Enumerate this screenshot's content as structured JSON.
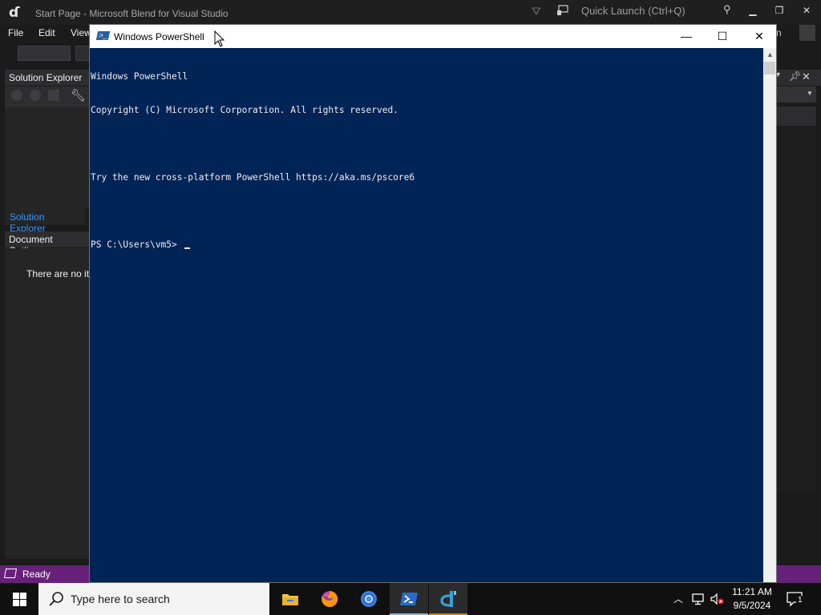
{
  "blend": {
    "title": "Start Page - Microsoft Blend for Visual Studio",
    "quick_launch_placeholder": "Quick Launch (Ctrl+Q)",
    "menu": [
      "File",
      "Edit",
      "View"
    ],
    "sign_in_stub": "n",
    "solution_explorer_title": "Solution Explorer",
    "solution_explorer_tab": "Solution Explorer",
    "document_outline_title": "Document Outline",
    "document_outline_empty": "There are no items to show.",
    "status_text": "Ready",
    "colors": {
      "status_bar": "#68217a",
      "accent_tab": "#3399ff"
    }
  },
  "powershell": {
    "title": "Windows PowerShell",
    "lines": [
      "Windows PowerShell",
      "Copyright (C) Microsoft Corporation. All rights reserved.",
      "",
      "Try the new cross-platform PowerShell https://aka.ms/pscore6",
      "",
      "PS C:\\Users\\vm5> "
    ],
    "colors": {
      "background": "#012456",
      "foreground": "#eeedf0"
    }
  },
  "taskbar": {
    "search_placeholder": "Type here to search",
    "apps": [
      {
        "name": "File Explorer",
        "icon": "folder-icon",
        "active": false
      },
      {
        "name": "Firefox",
        "icon": "firefox-icon",
        "active": false
      },
      {
        "name": "Chrome",
        "icon": "chrome-icon",
        "active": false
      },
      {
        "name": "Windows PowerShell",
        "icon": "powershell-icon",
        "active": true
      },
      {
        "name": "Blend for Visual Studio",
        "icon": "blend-icon",
        "active": true
      }
    ],
    "clock_time": "11:21 AM",
    "clock_date": "9/5/2024",
    "notification_count": "1"
  }
}
